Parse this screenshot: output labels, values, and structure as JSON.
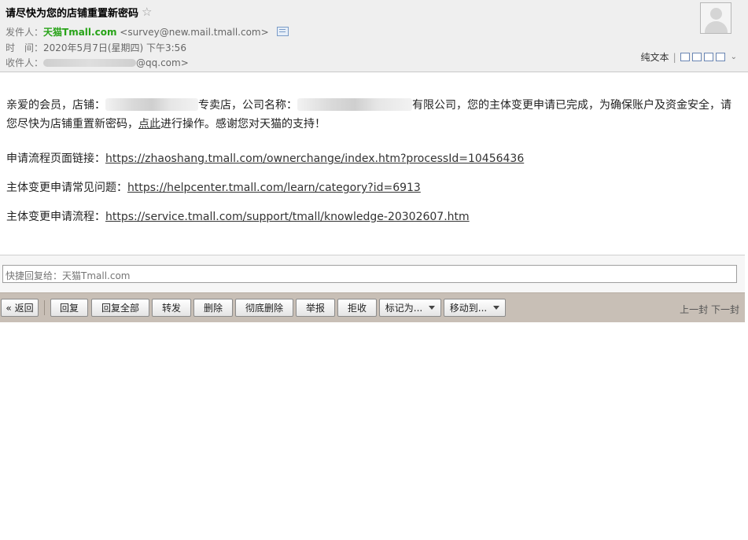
{
  "header": {
    "subject": "请尽快为您的店铺重置新密码",
    "from_label": "发件人：",
    "from_name": "天猫Tmall.com",
    "from_addr": "<survey@new.mail.tmall.com>",
    "time_label": "时　间：",
    "time_value": "2020年5月7日(星期四) 下午3:56",
    "to_label": "收件人：",
    "to_suffix": "@qq.com>",
    "plain_text_label": "纯文本",
    "separator": "|"
  },
  "body": {
    "greeting_part1": "亲爱的会员，店铺：",
    "greeting_part2": "专卖店，公司名称：",
    "greeting_part3": "有限公司，您的主体变更申请已完成，为确保账户及资金安全，请您尽快为店铺重置新密码，",
    "click_here": "点此",
    "greeting_part4": "进行操作。感谢您对天猫的支持！",
    "links": [
      {
        "label": "申请流程页面链接：",
        "url": "https://zhaoshang.tmall.com/ownerchange/index.htm?processId=10456436"
      },
      {
        "label": "主体变更申请常见问题：",
        "url": "https://helpcenter.tmall.com/learn/category?id=6913"
      },
      {
        "label": "主体变更申请流程：",
        "url": "https://service.tmall.com/support/tmall/knowledge-20302607.htm"
      }
    ]
  },
  "reply": {
    "placeholder": "快捷回复给：天猫Tmall.com"
  },
  "toolbar": {
    "back": "« 返回",
    "reply": "回复",
    "reply_all": "回复全部",
    "forward": "转发",
    "delete": "删除",
    "delete_permanently": "彻底删除",
    "report": "举报",
    "reject": "拒收",
    "mark_as": "标记为...",
    "move_to": "移动到...",
    "prev": "上一封",
    "next": "下一封"
  },
  "colors": {
    "sender": "#27a317",
    "toolbar_bg": "#c8bfb6",
    "header_bg": "#efefef"
  }
}
